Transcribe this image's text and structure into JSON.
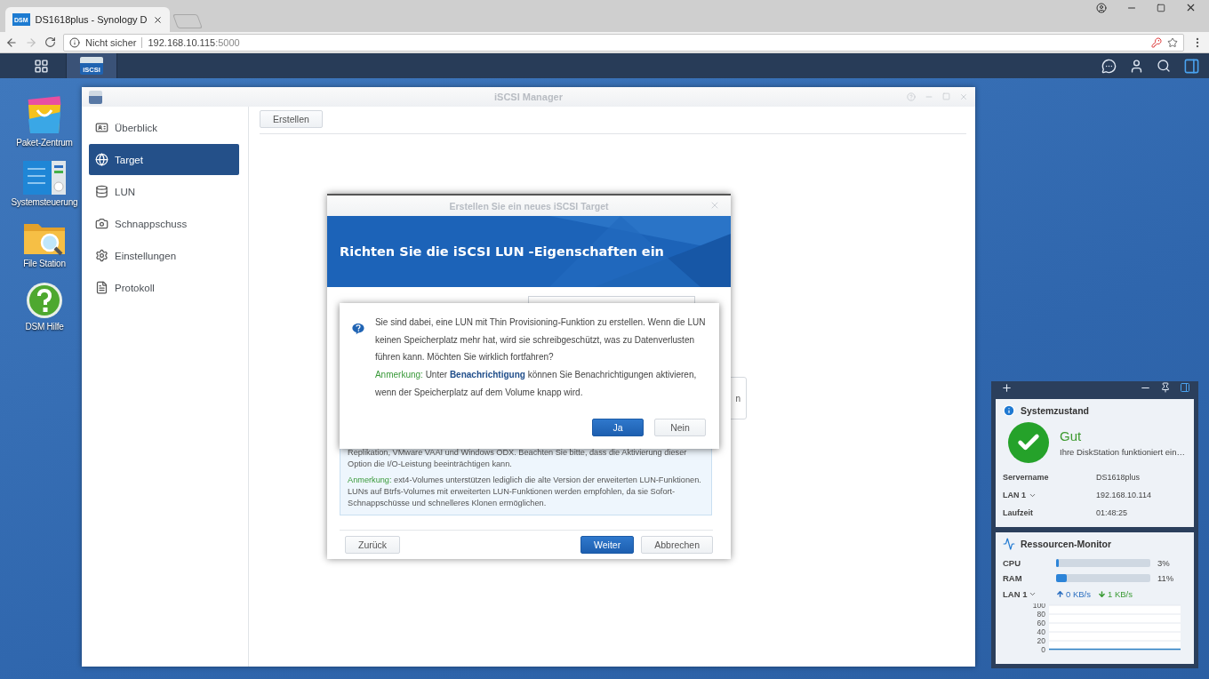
{
  "browser": {
    "tab": {
      "icon_text": "DSM",
      "title": "DS1618plus - Synology D"
    },
    "address": {
      "security": "Nicht sicher",
      "host": "192.168.10.115",
      "port": ":5000"
    }
  },
  "taskbar": {
    "apps": [
      {
        "label": "iSCSI",
        "selected": true
      }
    ]
  },
  "desktop_icons": [
    {
      "kind": "package",
      "label": "Paket-Zentrum"
    },
    {
      "kind": "control",
      "label": "Systemsteuerung"
    },
    {
      "kind": "files",
      "label": "File Station"
    },
    {
      "kind": "help",
      "label": "DSM Hilfe"
    }
  ],
  "iscsi_window": {
    "title": "iSCSI Manager",
    "sidebar": [
      {
        "kind": "overview",
        "label": "Überblick",
        "selected": false
      },
      {
        "kind": "target",
        "label": "Target",
        "selected": true
      },
      {
        "kind": "lun",
        "label": "LUN",
        "selected": false
      },
      {
        "kind": "snapshot",
        "label": "Schnappschuss",
        "selected": false
      },
      {
        "kind": "settings",
        "label": "Einstellungen",
        "selected": false
      },
      {
        "kind": "log",
        "label": "Protokoll",
        "selected": false
      }
    ],
    "create_button": "Erstellen"
  },
  "wizard": {
    "title": "Erstellen Sie ein neues iSCSI Target",
    "heading": "Richten Sie die iSCSI LUN -Eigenschaften ein",
    "info": "Replikation, VMware VAAI und Windows ODX. Beachten Sie bitte, dass die Aktivierung dieser Option die I/O-Leistung beeinträchtigen kann.",
    "note": {
      "label": "Anmerkung:",
      "text": "ext4-Volumes unterstützen lediglich die alte Version der erweiterten LUN-Funktionen. LUNs auf Btrfs-Volumes mit erweiterten LUN-Funktionen werden empfohlen, da sie Sofort-Schnappschüsse und schnelleres Klonen ermöglichen."
    },
    "buttons": {
      "back": "Zurück",
      "next": "Weiter",
      "cancel": "Abbrechen"
    }
  },
  "side_panel": {
    "text": "n"
  },
  "message": {
    "text": "Sie sind dabei, eine LUN mit Thin Provisioning-Funktion zu erstellen. Wenn die LUN keinen Speicherplatz mehr hat, wird sie schreibgeschützt, was zu Datenverlusten führen kann. Möchten Sie wirklich fortfahren?",
    "note": {
      "label": "Anmerkung:",
      "text": "Unter **Benachrichtigung** können Sie Benachrichtigungen aktivieren, wenn der Speicherplatz auf dem Volume knapp wird."
    },
    "buttons": [
      {
        "label": "Ja",
        "primary": true
      },
      {
        "label": "Nein",
        "primary": false
      }
    ]
  },
  "widgets": {
    "system": {
      "title": "Systemzustand",
      "status": "Gut",
      "description": "Ihre DiskStation funktioniert ein…",
      "rows": [
        {
          "label": "Servername",
          "value": "DS1618plus",
          "dropdown": false
        },
        {
          "label": "LAN 1",
          "value": "192.168.10.114",
          "dropdown": true
        },
        {
          "label": "Laufzeit",
          "value": "01:48:25",
          "dropdown": false
        }
      ]
    },
    "resources": {
      "title": "Ressourcen-Monitor",
      "meters": [
        {
          "label": "CPU",
          "level": 0.03,
          "reading": "3%"
        },
        {
          "label": "RAM",
          "level": 0.11,
          "reading": "11%"
        }
      ],
      "network": {
        "label": "LAN 1",
        "upload": "0 KB/s",
        "download": "1 KB/s"
      },
      "chart_data": {
        "type": "line",
        "grid": true,
        "ylim": [
          0,
          100
        ],
        "yticks": [
          0,
          20,
          40,
          60,
          80,
          100
        ],
        "series": [
          {
            "color": "#2a7fc4",
            "values": [
              1,
              1,
              1,
              1,
              1,
              1,
              1,
              1,
              1,
              1,
              1,
              1,
              1,
              1,
              1,
              1
            ]
          }
        ]
      }
    }
  }
}
